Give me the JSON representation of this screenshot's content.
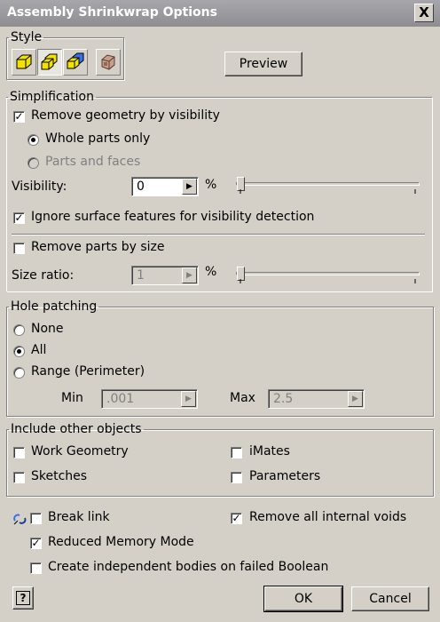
{
  "window": {
    "title": "Assembly Shrinkwrap Options",
    "close_label": "X"
  },
  "style": {
    "legend": "Style",
    "buttons": [
      {
        "icon": "single-composite-icon",
        "pressed": false
      },
      {
        "icon": "multiple-solid-icon",
        "pressed": true
      },
      {
        "icon": "surface-composite-icon",
        "pressed": false
      },
      {
        "icon": "assembly-part-icon",
        "pressed": false
      }
    ],
    "preview_label": "Preview"
  },
  "simplification": {
    "legend": "Simplification",
    "remove_by_visibility": {
      "label": "Remove geometry by visibility",
      "checked": true
    },
    "whole_parts": {
      "label": "Whole parts only",
      "selected": true
    },
    "parts_faces": {
      "label": "Parts and faces",
      "selected": false,
      "disabled": true
    },
    "visibility": {
      "label": "Visibility:",
      "value": "0",
      "unit": "%",
      "slider": 0
    },
    "ignore_surface": {
      "label": "Ignore surface features for visibility detection",
      "checked": true
    },
    "remove_by_size": {
      "label": "Remove parts by size",
      "checked": false
    },
    "size_ratio": {
      "label": "Size ratio:",
      "value": "1",
      "unit": "%",
      "slider": 0
    }
  },
  "hole_patching": {
    "legend": "Hole patching",
    "none": {
      "label": "None",
      "selected": false
    },
    "all": {
      "label": "All",
      "selected": true
    },
    "range": {
      "label": "Range (Perimeter)",
      "selected": false
    },
    "min": {
      "label": "Min",
      "value": ".001"
    },
    "max": {
      "label": "Max",
      "value": "2.5"
    }
  },
  "include_other": {
    "legend": "Include other objects",
    "work_geometry": {
      "label": "Work Geometry",
      "checked": false
    },
    "imates": {
      "label": "iMates",
      "checked": false
    },
    "sketches": {
      "label": "Sketches",
      "checked": false
    },
    "parameters": {
      "label": "Parameters",
      "checked": false
    }
  },
  "options": {
    "break_link": {
      "label": "Break link",
      "checked": false
    },
    "remove_voids": {
      "label": "Remove all internal voids",
      "checked": true
    },
    "reduced_memory": {
      "label": "Reduced Memory Mode",
      "checked": true
    },
    "independent_bodies": {
      "label": "Create independent bodies on failed Boolean",
      "checked": false
    }
  },
  "footer": {
    "help_label": "?",
    "ok_label": "OK",
    "cancel_label": "Cancel"
  },
  "colors": {
    "titlebar": "#9a999d",
    "dialog_bg": "#d4d0c8",
    "icon_yellow": "#f2e200",
    "icon_blue": "#3a6ee8"
  }
}
